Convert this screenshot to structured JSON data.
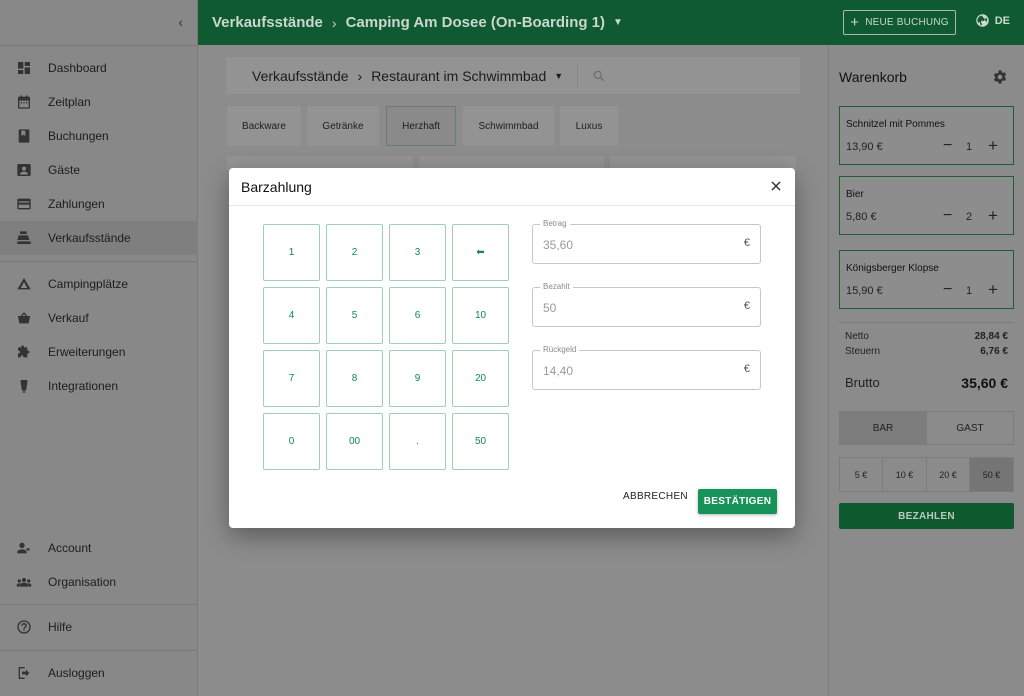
{
  "topbar": {
    "crumb1": "Verkaufsstände",
    "crumb2": "Camping Am Dosee (On-Boarding 1)",
    "new_booking": "NEUE BUCHUNG",
    "lang": "DE"
  },
  "sidebar": {
    "items": [
      {
        "label": "Dashboard",
        "icon": "dashboard-icon"
      },
      {
        "label": "Zeitplan",
        "icon": "calendar-icon"
      },
      {
        "label": "Buchungen",
        "icon": "book-icon"
      },
      {
        "label": "Gäste",
        "icon": "contact-icon"
      },
      {
        "label": "Zahlungen",
        "icon": "credit-card-icon"
      },
      {
        "label": "Verkaufsstände",
        "icon": "register-icon"
      },
      {
        "label": "Campingplätze",
        "icon": "tent-icon"
      },
      {
        "label": "Verkauf",
        "icon": "basket-icon"
      },
      {
        "label": "Erweiterungen",
        "icon": "puzzle-icon"
      },
      {
        "label": "Integrationen",
        "icon": "plug-icon"
      }
    ],
    "bottom": [
      {
        "label": "Account",
        "icon": "account-icon"
      },
      {
        "label": "Organisation",
        "icon": "group-icon"
      },
      {
        "label": "Hilfe",
        "icon": "help-icon"
      },
      {
        "label": "Ausloggen",
        "icon": "logout-icon"
      }
    ]
  },
  "main": {
    "crumb1": "Verkaufsstände",
    "crumb2": "Restaurant im Schwimmbad",
    "tabs": [
      "Backware",
      "Getränke",
      "Herzhaft",
      "Schwimmbad",
      "Luxus"
    ]
  },
  "cart": {
    "title": "Warenkorb",
    "items": [
      {
        "name": "Schnitzel mit Pommes",
        "price": "13,90 €",
        "qty": "1"
      },
      {
        "name": "Bier",
        "price": "5,80 €",
        "qty": "2"
      },
      {
        "name": "Königsberger Klopse",
        "price": "15,90 €",
        "qty": "1"
      }
    ],
    "netto_label": "Netto",
    "netto": "28,84 €",
    "steuern_label": "Steuern",
    "steuern": "6,76 €",
    "brutto_label": "Brutto",
    "brutto": "35,60 €",
    "method_bar": "BAR",
    "method_gast": "GAST",
    "quick": [
      "5 €",
      "10 €",
      "20 €",
      "50 €"
    ],
    "pay": "BEZAHLEN"
  },
  "modal": {
    "title": "Barzahlung",
    "keys": [
      "1",
      "2",
      "3",
      "⬅",
      "4",
      "5",
      "6",
      "10",
      "7",
      "8",
      "9",
      "20",
      "0",
      "00",
      ".",
      "50"
    ],
    "betrag_label": "Betrag",
    "betrag": "35,60",
    "bezahlt_label": "Bezahlt",
    "bezahlt": "50",
    "rueckgeld_label": "Rückgeld",
    "rueckgeld": "14,40",
    "currency": "€",
    "cancel": "ABBRECHEN",
    "confirm": "BESTÄTIGEN"
  },
  "colors": {
    "brand": "#0f5a30",
    "accent": "#17935a"
  }
}
